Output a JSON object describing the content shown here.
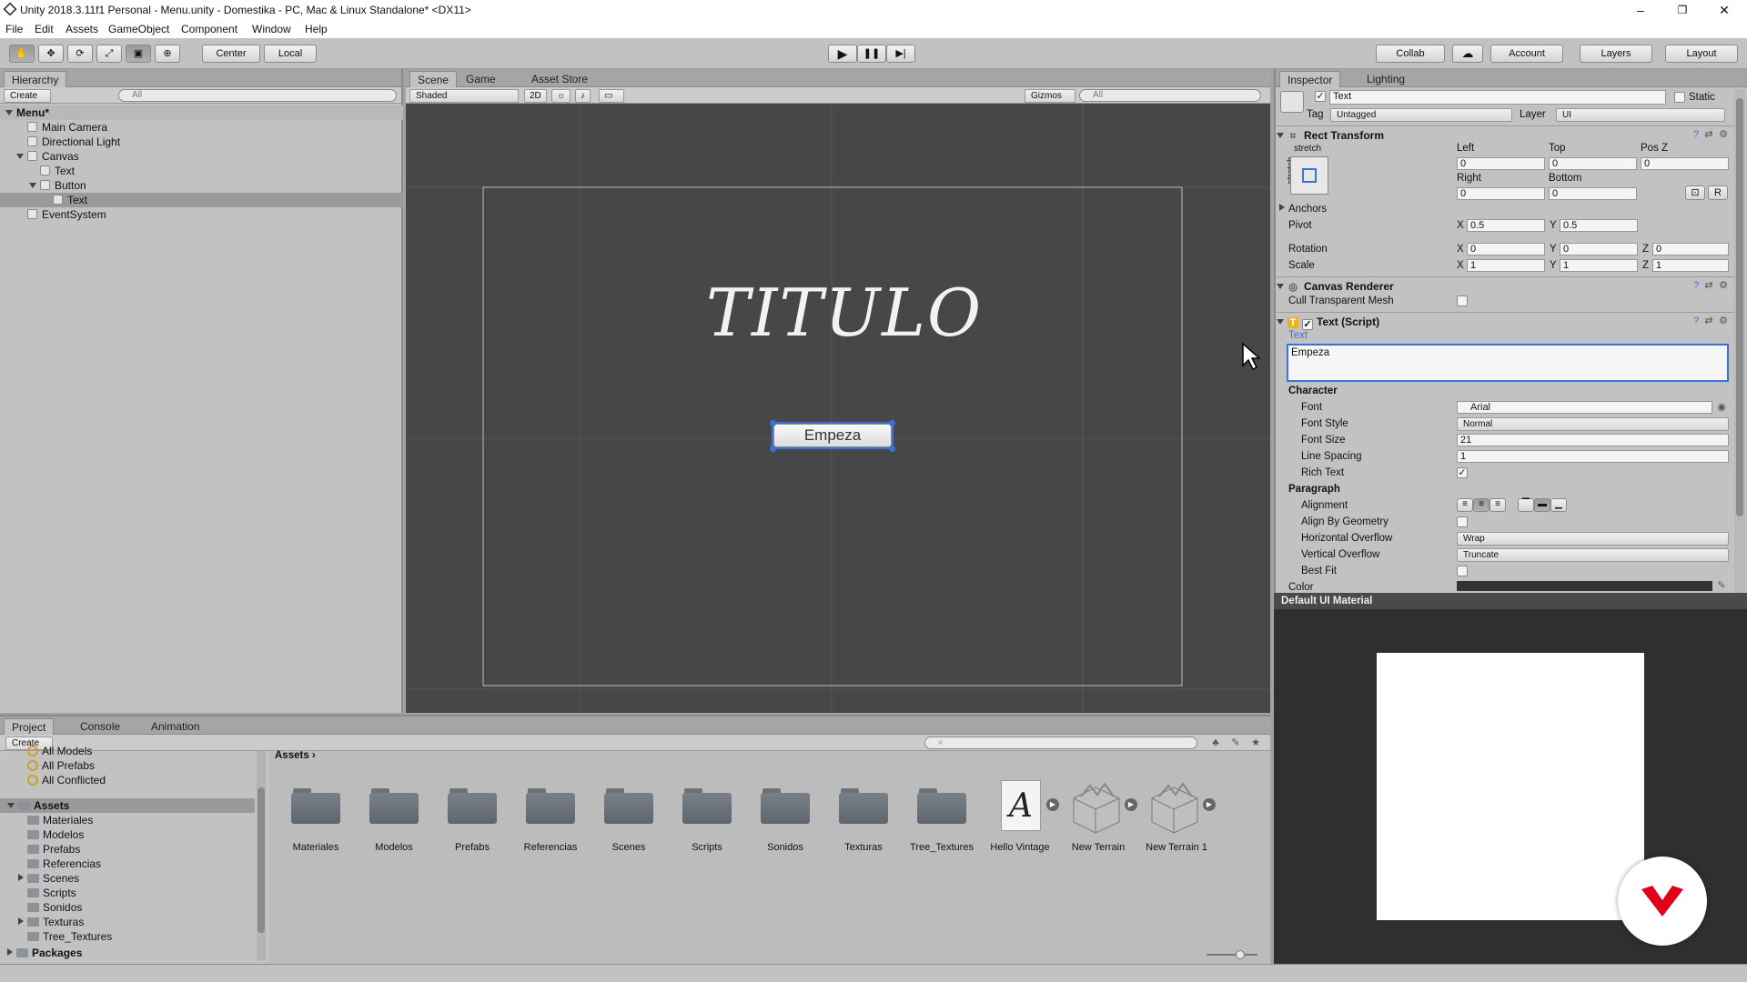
{
  "window": {
    "title": "Unity 2018.3.11f1 Personal - Menu.unity - Domestika - PC, Mac & Linux Standalone* <DX11>",
    "minimize": "–",
    "restore": "❐",
    "close": "✕"
  },
  "menu": [
    "File",
    "Edit",
    "Assets",
    "GameObject",
    "Component",
    "Window",
    "Help"
  ],
  "toolbar": {
    "tools": [
      "✋",
      "✥",
      "⟳",
      "⤢",
      "▣",
      "⊕"
    ],
    "center": "Center",
    "local": "Local",
    "play": "▶",
    "pause": "❚❚",
    "step": "▶|",
    "collab": "Collab",
    "cloud": "☁",
    "account": "Account",
    "layers": "Layers",
    "layout": "Layout"
  },
  "hierarchy": {
    "tab": "Hierarchy",
    "create": "Create",
    "search": "All",
    "scene": "Menu*",
    "items": [
      "Main Camera",
      "Directional Light",
      "Canvas",
      "Text",
      "Button",
      "Text",
      "EventSystem"
    ]
  },
  "scene": {
    "tabs": [
      "Scene",
      "Game",
      "Asset Store"
    ],
    "shaded": "Shaded",
    "mode2d": "2D",
    "gizmos": "Gizmos",
    "search": "All",
    "title": "TITULO",
    "button": "Empeza"
  },
  "inspector": {
    "tabs": [
      "Inspector",
      "Lighting"
    ],
    "objname": "Text",
    "static": "Static",
    "tag_label": "Tag",
    "tag": "Untagged",
    "layer_label": "Layer",
    "layer": "UI",
    "rect": {
      "title": "Rect Transform",
      "stretch": "stretch",
      "stretch_v": "stretch",
      "left": "Left",
      "top": "Top",
      "posz": "Pos Z",
      "left_v": "0",
      "top_v": "0",
      "posz_v": "0",
      "right": "Right",
      "bottom": "Bottom",
      "right_v": "0",
      "bottom_v": "0",
      "raw": "R",
      "anchors": "Anchors",
      "pivot": "Pivot",
      "pivot_x": "0.5",
      "pivot_y": "0.5",
      "rotation": "Rotation",
      "rot_x": "0",
      "rot_y": "0",
      "rot_z": "0",
      "scale": "Scale",
      "sc_x": "1",
      "sc_y": "1",
      "sc_z": "1",
      "x": "X",
      "y": "Y",
      "z": "Z"
    },
    "canvas": {
      "title": "Canvas Renderer",
      "cull": "Cull Transparent Mesh"
    },
    "text": {
      "title": "Text (Script)",
      "label": "Text",
      "value": "Empeza",
      "character": "Character",
      "font": "Font",
      "font_v": "Arial",
      "fontstyle": "Font Style",
      "fontstyle_v": "Normal",
      "fontsize": "Font Size",
      "fontsize_v": "21",
      "linespacing": "Line Spacing",
      "linespacing_v": "1",
      "richtext": "Rich Text",
      "paragraph": "Paragraph",
      "alignment": "Alignment",
      "aligngeo": "Align By Geometry",
      "hover": "Horizontal Overflow",
      "hover_v": "Wrap",
      "vover": "Vertical Overflow",
      "vover_v": "Truncate",
      "bestfit": "Best Fit",
      "color": "Color"
    },
    "material": "Default UI Material"
  },
  "project": {
    "tabs": [
      "Project",
      "Console",
      "Animation"
    ],
    "create": "Create",
    "favorites": [
      "All Models",
      "All Prefabs",
      "All Conflicted"
    ],
    "assets_root": "Assets",
    "tree": [
      "Materiales",
      "Modelos",
      "Prefabs",
      "Referencias",
      "Scenes",
      "Scripts",
      "Sonidos",
      "Texturas",
      "Tree_Textures"
    ],
    "packages": "Packages",
    "breadcrumb": "Assets",
    "folders": [
      "Materiales",
      "Modelos",
      "Prefabs",
      "Referencias",
      "Scenes",
      "Scripts",
      "Sonidos",
      "Texturas",
      "Tree_Textures"
    ],
    "font_asset": "Hello Vintage",
    "font_glyph": "A",
    "terrains": [
      "New Terrain",
      "New Terrain 1"
    ]
  },
  "colors": {
    "scene_bg": "#474747",
    "accent": "#3a72d8",
    "brand": "#e0001b"
  }
}
